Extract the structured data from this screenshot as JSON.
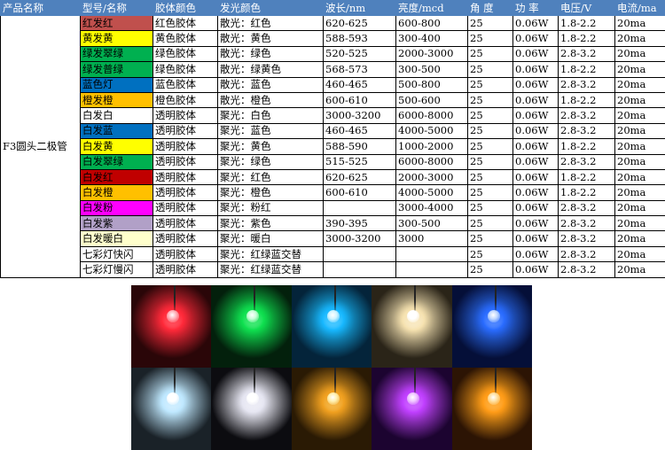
{
  "header": [
    "产品名称",
    "型号/名称",
    "胶体颜色",
    "发光颜色",
    "波长/nm",
    "亮度/mcd",
    "角  度",
    "功  率",
    "电压/V",
    "电流/ma"
  ],
  "product_name": "F3圆头二极管",
  "rows": [
    {
      "model": "红发红",
      "model_bg": "#c0504d",
      "body": "红色胶体",
      "emit": "散光：红色",
      "wave": "620-625",
      "lum": "600-800",
      "angle": "25",
      "power": "0.06W",
      "volt": "1.8-2.2",
      "curr": "20ma"
    },
    {
      "model": "黄发黄",
      "model_bg": "#ffff00",
      "body": "黄色胶体",
      "emit": "散光：黄色",
      "wave": "588-593",
      "lum": "300-400",
      "angle": "25",
      "power": "0.06W",
      "volt": "1.8-2.2",
      "curr": "20ma"
    },
    {
      "model": "绿发翠绿",
      "model_bg": "#00b050",
      "body": "绿色胶体",
      "emit": "散光：绿色",
      "wave": "520-525",
      "lum": "2000-3000",
      "angle": "25",
      "power": "0.06W",
      "volt": "2.8-3.2",
      "curr": "20ma"
    },
    {
      "model": "绿发普绿",
      "model_bg": "#00b050",
      "body": "绿色胶体",
      "emit": "散光：绿黄色",
      "wave": "568-573",
      "lum": "300-500",
      "angle": "25",
      "power": "0.06W",
      "volt": "1.8-2.2",
      "curr": "20ma"
    },
    {
      "model": "蓝色灯",
      "model_bg": "#0070c0",
      "body": "蓝色胶体",
      "emit": "散光：蓝色",
      "wave": "460-465",
      "lum": "500-800",
      "angle": "25",
      "power": "0.06W",
      "volt": "2.8-3.2",
      "curr": "20ma"
    },
    {
      "model": "橙发橙",
      "model_bg": "#ffc000",
      "body": "橙色胶体",
      "emit": "散光：橙色",
      "wave": "600-610",
      "lum": "500-600",
      "angle": "25",
      "power": "0.06W",
      "volt": "1.8-2.2",
      "curr": "20ma"
    },
    {
      "model": "白发白",
      "model_bg": "#ffffff",
      "body": "透明胶体",
      "emit": "聚光：白色",
      "wave": "3000-3200",
      "lum": "6000-8000",
      "angle": "25",
      "power": "0.06W",
      "volt": "2.8-3.2",
      "curr": "20ma"
    },
    {
      "model": "白发蓝",
      "model_bg": "#0070c0",
      "body": "透明胶体",
      "emit": "聚光：蓝色",
      "wave": "460-465",
      "lum": "4000-5000",
      "angle": "25",
      "power": "0.06W",
      "volt": "2.8-3.2",
      "curr": "20ma"
    },
    {
      "model": "白发黄",
      "model_bg": "#ffff00",
      "body": "透明胶体",
      "emit": "聚光：黄色",
      "wave": "588-590",
      "lum": "1000-2000",
      "angle": "25",
      "power": "0.06W",
      "volt": "1.8-2.2",
      "curr": "20ma"
    },
    {
      "model": "白发翠绿",
      "model_bg": "#00b050",
      "body": "透明胶体",
      "emit": "聚光：绿色",
      "wave": "515-525",
      "lum": "6000-8000",
      "angle": "25",
      "power": "0.06W",
      "volt": "2.8-3.2",
      "curr": "20ma"
    },
    {
      "model": "白发红",
      "model_bg": "#c00000",
      "body": "透明胶体",
      "emit": "聚光：红色",
      "wave": "620-625",
      "lum": "2000-3000",
      "angle": "25",
      "power": "0.06W",
      "volt": "1.8-2.2",
      "curr": "20ma"
    },
    {
      "model": "白发橙",
      "model_bg": "#ffc000",
      "body": "透明胶体",
      "emit": "聚光：橙色",
      "wave": "600-610",
      "lum": "4000-5000",
      "angle": "25",
      "power": "0.06W",
      "volt": "1.8-2.2",
      "curr": "20ma"
    },
    {
      "model": "白发粉",
      "model_bg": "#ff00ff",
      "body": "透明胶体",
      "emit": "聚光：粉红",
      "wave": "",
      "lum": "3000-4000",
      "angle": "25",
      "power": "0.06W",
      "volt": "2.8-3.2",
      "curr": "20ma"
    },
    {
      "model": "白发紫",
      "model_bg": "#b1a0c7",
      "body": "透明胶体",
      "emit": "聚光：紫色",
      "wave": "390-395",
      "lum": "300-500",
      "angle": "25",
      "power": "0.06W",
      "volt": "2.8-3.2",
      "curr": "20ma"
    },
    {
      "model": "白发暖白",
      "model_bg": "#ffffcc",
      "body": "透明胶体",
      "emit": "聚光：暖白",
      "wave": "3000-3200",
      "lum": "3000",
      "angle": "25",
      "power": "0.06W",
      "volt": "2.8-3.2",
      "curr": "20ma"
    },
    {
      "model": "七彩灯快闪",
      "model_bg": "#ffffff",
      "body": "透明胶体",
      "emit": "聚光：红绿蓝交替",
      "wave": "",
      "lum": "",
      "angle": "25",
      "power": "0.06W",
      "volt": "2.8-3.2",
      "curr": "20ma"
    },
    {
      "model": "七彩灯慢闪",
      "model_bg": "#ffffff",
      "body": "透明胶体",
      "emit": "聚光：红绿蓝交替",
      "wave": "",
      "lum": "",
      "angle": "25",
      "power": "0.06W",
      "volt": "2.8-3.2",
      "curr": "20ma"
    }
  ],
  "photos": [
    {
      "color": "#ff2a3a",
      "bg": "#2a0608",
      "core": "#ffb0b8"
    },
    {
      "color": "#10e050",
      "bg": "#03200c",
      "core": "#c8ffd8"
    },
    {
      "color": "#18b8ff",
      "bg": "#04243a",
      "core": "#d0f4ff"
    },
    {
      "color": "#f6e2b0",
      "bg": "#2a2418",
      "core": "#ffffff"
    },
    {
      "color": "#2a6cff",
      "bg": "#050f38",
      "core": "#c0d8ff"
    },
    {
      "color": "#bfe8ff",
      "bg": "#1a2228",
      "core": "#ffffff"
    },
    {
      "color": "#e6e6f2",
      "bg": "#0c0c10",
      "core": "#ffffff"
    },
    {
      "color": "#f0a020",
      "bg": "#2a1a04",
      "core": "#fff0b0"
    },
    {
      "color": "#c040ff",
      "bg": "#1c0430",
      "core": "#f0c8ff"
    },
    {
      "color": "#ff9c18",
      "bg": "#2c1404",
      "core": "#ffe0a0"
    }
  ]
}
